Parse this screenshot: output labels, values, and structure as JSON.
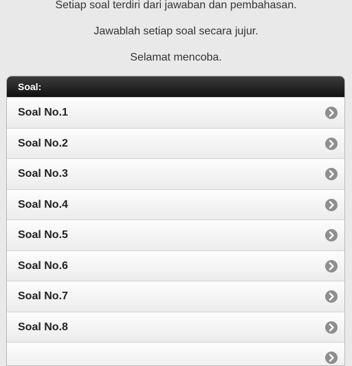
{
  "intro": {
    "line1": "Setiap soal terdiri dari jawaban dan pembahasan.",
    "line2": "Jawablah setiap soal secara jujur.",
    "line3": "Selamat mencoba."
  },
  "list": {
    "header": "Soal:",
    "items": [
      {
        "label": "Soal No.1"
      },
      {
        "label": "Soal No.2"
      },
      {
        "label": "Soal No.3"
      },
      {
        "label": "Soal No.4"
      },
      {
        "label": "Soal No.5"
      },
      {
        "label": "Soal No.6"
      },
      {
        "label": "Soal No.7"
      },
      {
        "label": "Soal No.8"
      },
      {
        "label": ""
      }
    ]
  },
  "colors": {
    "background": "#e9e9e9",
    "header_bg": "#111111",
    "arrow": "#8e8e8e"
  }
}
